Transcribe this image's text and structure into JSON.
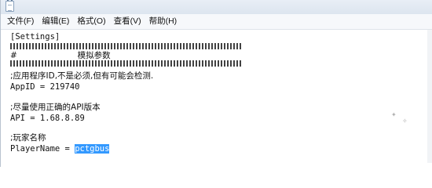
{
  "menu": {
    "items": [
      "文件(F)",
      "编辑(E)",
      "格式(O)",
      "查看(V)",
      "帮助(H)"
    ]
  },
  "editor": {
    "section": "[Settings]",
    "comment_title": "#                       模拟参数",
    "comment_appid": ";应用程序ID,不是必须,但有可能会检测.",
    "appid_line": "AppID = 219740",
    "comment_api": ";尽量使用正确的API版本",
    "api_line": "API = 1.68.8.89",
    "comment_player": ";玩家名称",
    "player_key": "PlayerName = ",
    "player_value": "pctgbus"
  }
}
